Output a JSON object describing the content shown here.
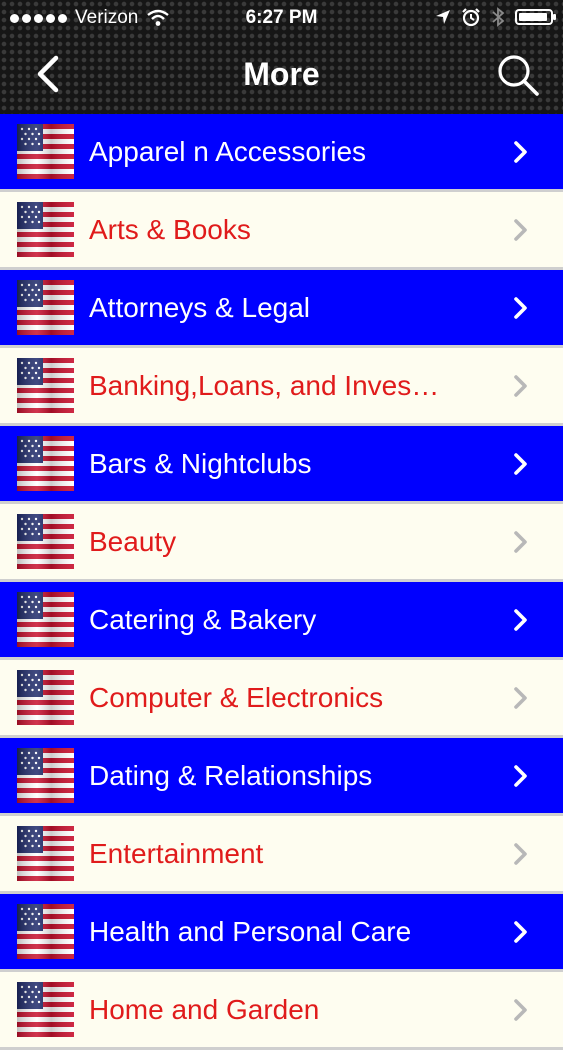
{
  "status_bar": {
    "carrier": "Verizon",
    "time": "6:27 PM",
    "battery_level": 0.92,
    "icons": [
      "signal-dots-icon",
      "wifi-icon",
      "location-arrow-icon",
      "alarm-icon",
      "bluetooth-icon",
      "battery-icon"
    ]
  },
  "nav": {
    "title": "More",
    "back_icon": "chevron-left-icon",
    "search_icon": "search-icon"
  },
  "colors": {
    "row_blue": "#0000ff",
    "row_cream": "#fefdf0",
    "text_on_blue": "#ffffff",
    "text_on_cream": "#e01b1b",
    "chevron_on_blue": "#ffffff",
    "chevron_on_cream": "#b8b8b8"
  },
  "categories": [
    {
      "label": "Apparel n Accessories",
      "style": "blue"
    },
    {
      "label": "Arts & Books",
      "style": "cream"
    },
    {
      "label": "Attorneys & Legal",
      "style": "blue"
    },
    {
      "label": "Banking,Loans, and Inves…",
      "style": "cream"
    },
    {
      "label": "Bars & Nightclubs",
      "style": "blue"
    },
    {
      "label": "Beauty",
      "style": "cream"
    },
    {
      "label": "Catering & Bakery",
      "style": "blue"
    },
    {
      "label": "Computer & Electronics",
      "style": "cream"
    },
    {
      "label": "Dating & Relationships",
      "style": "blue"
    },
    {
      "label": "Entertainment",
      "style": "cream"
    },
    {
      "label": "Health and Personal Care",
      "style": "blue"
    },
    {
      "label": "Home and Garden",
      "style": "cream"
    }
  ]
}
